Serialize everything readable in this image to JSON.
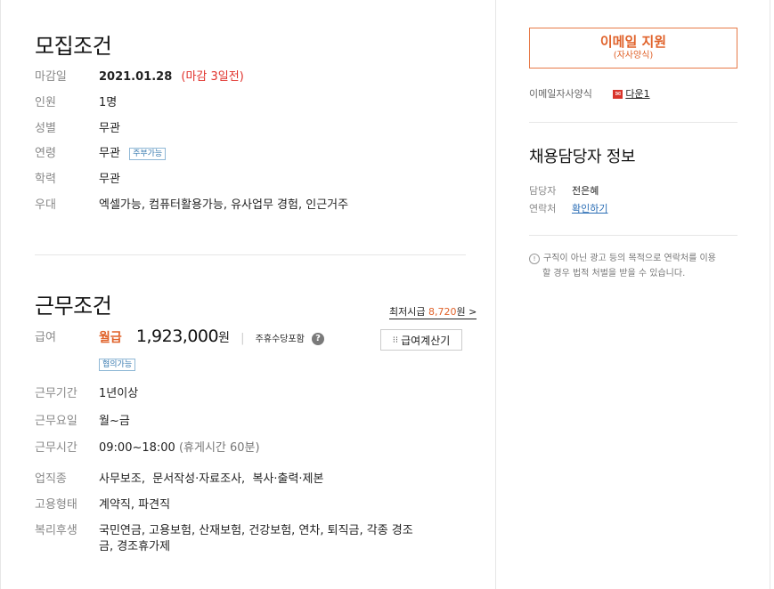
{
  "recruit": {
    "title": "모집조건",
    "rows": [
      {
        "label": "마감일",
        "value": "2021.01.28",
        "extra": "(마감 3일전)"
      },
      {
        "label": "인원",
        "value": "1명"
      },
      {
        "label": "성별",
        "value": "무관"
      },
      {
        "label": "연령",
        "value": "무관",
        "tag": "주부가능"
      },
      {
        "label": "학력",
        "value": "무관"
      },
      {
        "label": "우대",
        "value": "엑셀가능, 컴퓨터활용가능, 유사업무 경험, 인근거주"
      }
    ]
  },
  "work": {
    "title": "근무조건",
    "min_wage_label": "최저시급",
    "min_wage_value": "8,720",
    "min_wage_suffix": "원 >",
    "pay": {
      "label": "급여",
      "type": "월급",
      "amount": "1,923,000",
      "unit": "원",
      "separator": "|",
      "holiday_note": "주휴수당포함",
      "help": "?",
      "negotiable_tag": "협의가능",
      "calc_icon": "calculator-icon",
      "calc_label": "급여계산기"
    },
    "rows": [
      {
        "label": "근무기간",
        "value": "1년이상"
      },
      {
        "label": "근무요일",
        "value": "월~금"
      },
      {
        "label": "근무시간",
        "value": "09:00~18:00",
        "extra": "(휴게시간 60분)"
      },
      {
        "label": "업직종",
        "value": "사무보조,  문서작성·자료조사,  복사·출력·제본"
      },
      {
        "label": "고용형태",
        "value": "계약직, 파견직"
      },
      {
        "label": "복리후생",
        "value_line1": "국민연금, 고용보험, 산재보험, 건강보험, 연차, 퇴직금, 각종 경조",
        "value_line2": "금, 경조휴가제"
      }
    ]
  },
  "sidebar": {
    "apply_label": "이메일 지원",
    "apply_sub": "(자사양식)",
    "form_label": "이메일자사양식",
    "form_file_icon": "file-icon",
    "form_file": "다운1",
    "contact_title": "채용담당자 정보",
    "manager_label": "담당자",
    "manager_value": "전은혜",
    "contact_label": "연락처",
    "contact_link": "확인하기",
    "notice_line1": "구직이 아닌 광고 등의 목적으로 연락처를 이용",
    "notice_line2": "할 경우 법적 처벌을 받을 수 있습니다."
  }
}
